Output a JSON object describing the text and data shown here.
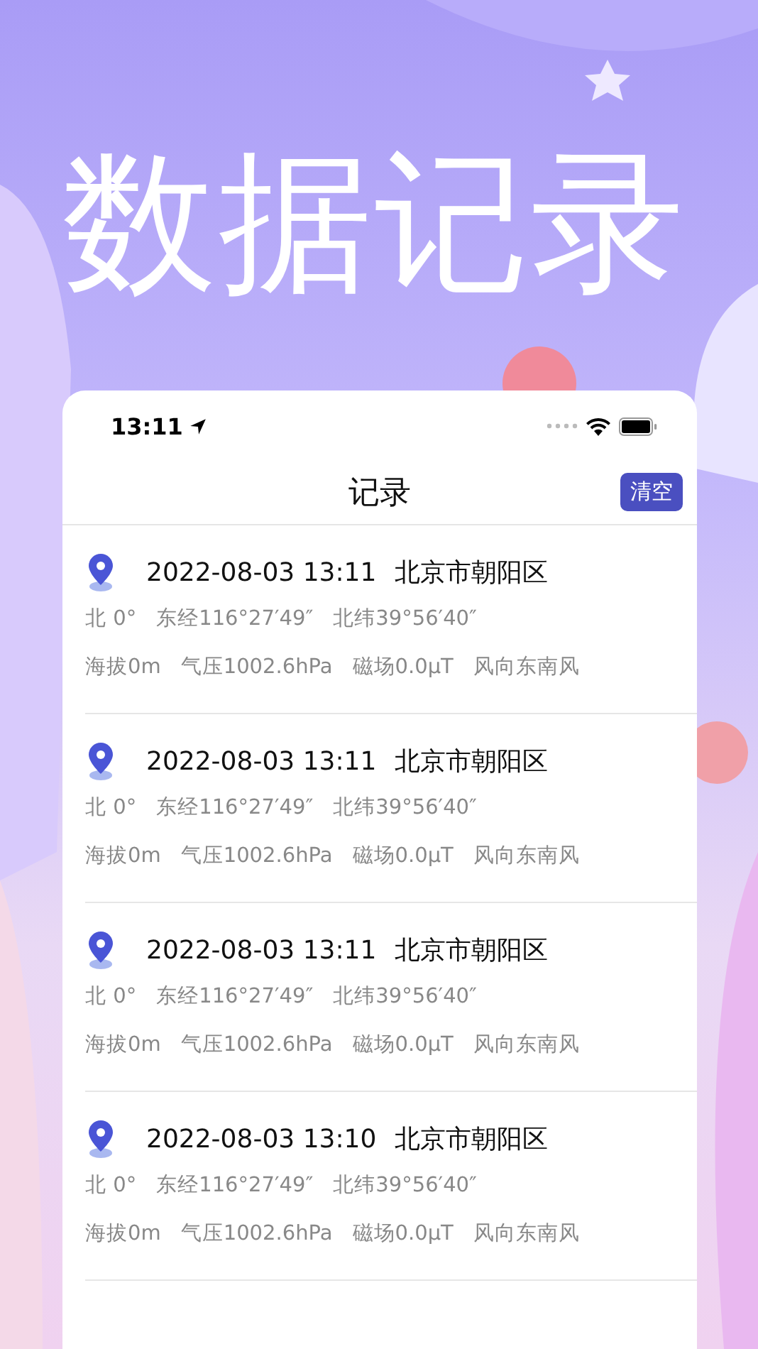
{
  "headline": "数据记录",
  "status_bar": {
    "time": "13:11"
  },
  "nav": {
    "title": "记录",
    "action": "清空"
  },
  "records": [
    {
      "datetime": "2022-08-03 13:11",
      "place": "北京市朝阳区",
      "position": [
        "北 0°",
        "东经116°27′49″",
        "北纬39°56′40″"
      ],
      "readings": [
        "海拔0m",
        "气压1002.6hPa",
        "磁场0.0μT",
        "风向东南风"
      ]
    },
    {
      "datetime": "2022-08-03 13:11",
      "place": "北京市朝阳区",
      "position": [
        "北 0°",
        "东经116°27′49″",
        "北纬39°56′40″"
      ],
      "readings": [
        "海拔0m",
        "气压1002.6hPa",
        "磁场0.0μT",
        "风向东南风"
      ]
    },
    {
      "datetime": "2022-08-03 13:11",
      "place": "北京市朝阳区",
      "position": [
        "北 0°",
        "东经116°27′49″",
        "北纬39°56′40″"
      ],
      "readings": [
        "海拔0m",
        "气压1002.6hPa",
        "磁场0.0μT",
        "风向东南风"
      ]
    },
    {
      "datetime": "2022-08-03 13:10",
      "place": "北京市朝阳区",
      "position": [
        "北 0°",
        "东经116°27′49″",
        "北纬39°56′40″"
      ],
      "readings": [
        "海拔0m",
        "气压1002.6hPa",
        "磁场0.0μT",
        "风向东南风"
      ]
    }
  ]
}
